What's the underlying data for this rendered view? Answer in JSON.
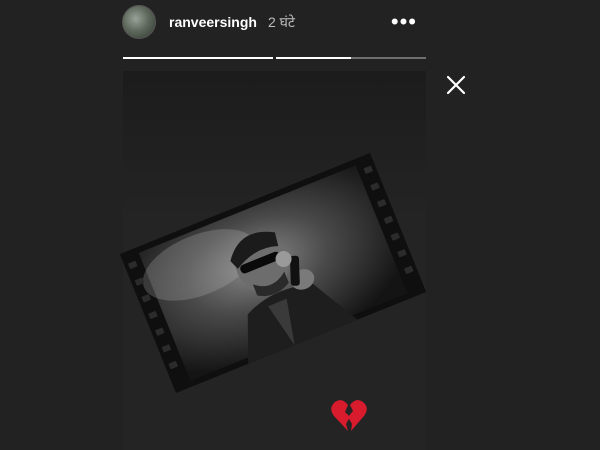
{
  "header": {
    "username": "ranveersingh",
    "time": "2 घंटे",
    "more_label": "•••"
  },
  "progress": {
    "segments": [
      {
        "fill": 1.0
      },
      {
        "fill": 0.5
      }
    ]
  },
  "icons": {
    "avatar": "avatar-image",
    "close": "close-icon",
    "more": "more-options-icon",
    "reaction": "broken-heart-icon"
  },
  "colors": {
    "background": "#222222",
    "text": "#ffffff",
    "muted": "#bdbdbd",
    "heart": "#d81b2d"
  }
}
